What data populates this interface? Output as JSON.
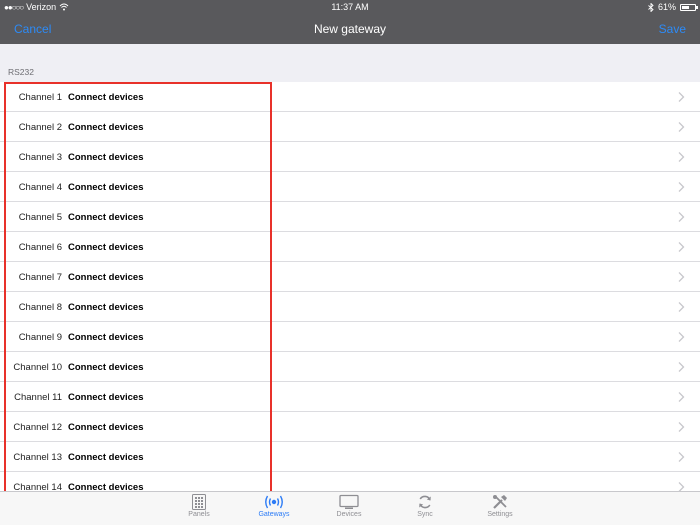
{
  "status_bar": {
    "carrier": "Verizon",
    "time": "11:37 AM",
    "battery": "61%",
    "battery_level": 0.61
  },
  "nav": {
    "cancel_label": "Cancel",
    "title": "New gateway",
    "save_label": "Save"
  },
  "section": {
    "header": "RS232"
  },
  "channels": [
    {
      "label": "Channel 1",
      "value": "Connect devices"
    },
    {
      "label": "Channel 2",
      "value": "Connect devices"
    },
    {
      "label": "Channel 3",
      "value": "Connect devices"
    },
    {
      "label": "Channel 4",
      "value": "Connect devices"
    },
    {
      "label": "Channel 5",
      "value": "Connect devices"
    },
    {
      "label": "Channel 6",
      "value": "Connect devices"
    },
    {
      "label": "Channel 7",
      "value": "Connect devices"
    },
    {
      "label": "Channel 8",
      "value": "Connect devices"
    },
    {
      "label": "Channel 9",
      "value": "Connect devices"
    },
    {
      "label": "Channel 10",
      "value": "Connect devices"
    },
    {
      "label": "Channel 11",
      "value": "Connect devices"
    },
    {
      "label": "Channel 12",
      "value": "Connect devices"
    },
    {
      "label": "Channel 13",
      "value": "Connect devices"
    },
    {
      "label": "Channel 14",
      "value": "Connect devices"
    }
  ],
  "tabs": [
    {
      "label": "Panels",
      "icon": "keypad-icon",
      "active": false
    },
    {
      "label": "Gateways",
      "icon": "broadcast-icon",
      "active": true
    },
    {
      "label": "Devices",
      "icon": "monitor-icon",
      "active": false
    },
    {
      "label": "Sync",
      "icon": "sync-icon",
      "active": false
    },
    {
      "label": "Settings",
      "icon": "tools-icon",
      "active": false
    }
  ],
  "colors": {
    "accent": "#2d8bf7",
    "nav_background": "#59595c",
    "highlight": "#e8312a"
  }
}
